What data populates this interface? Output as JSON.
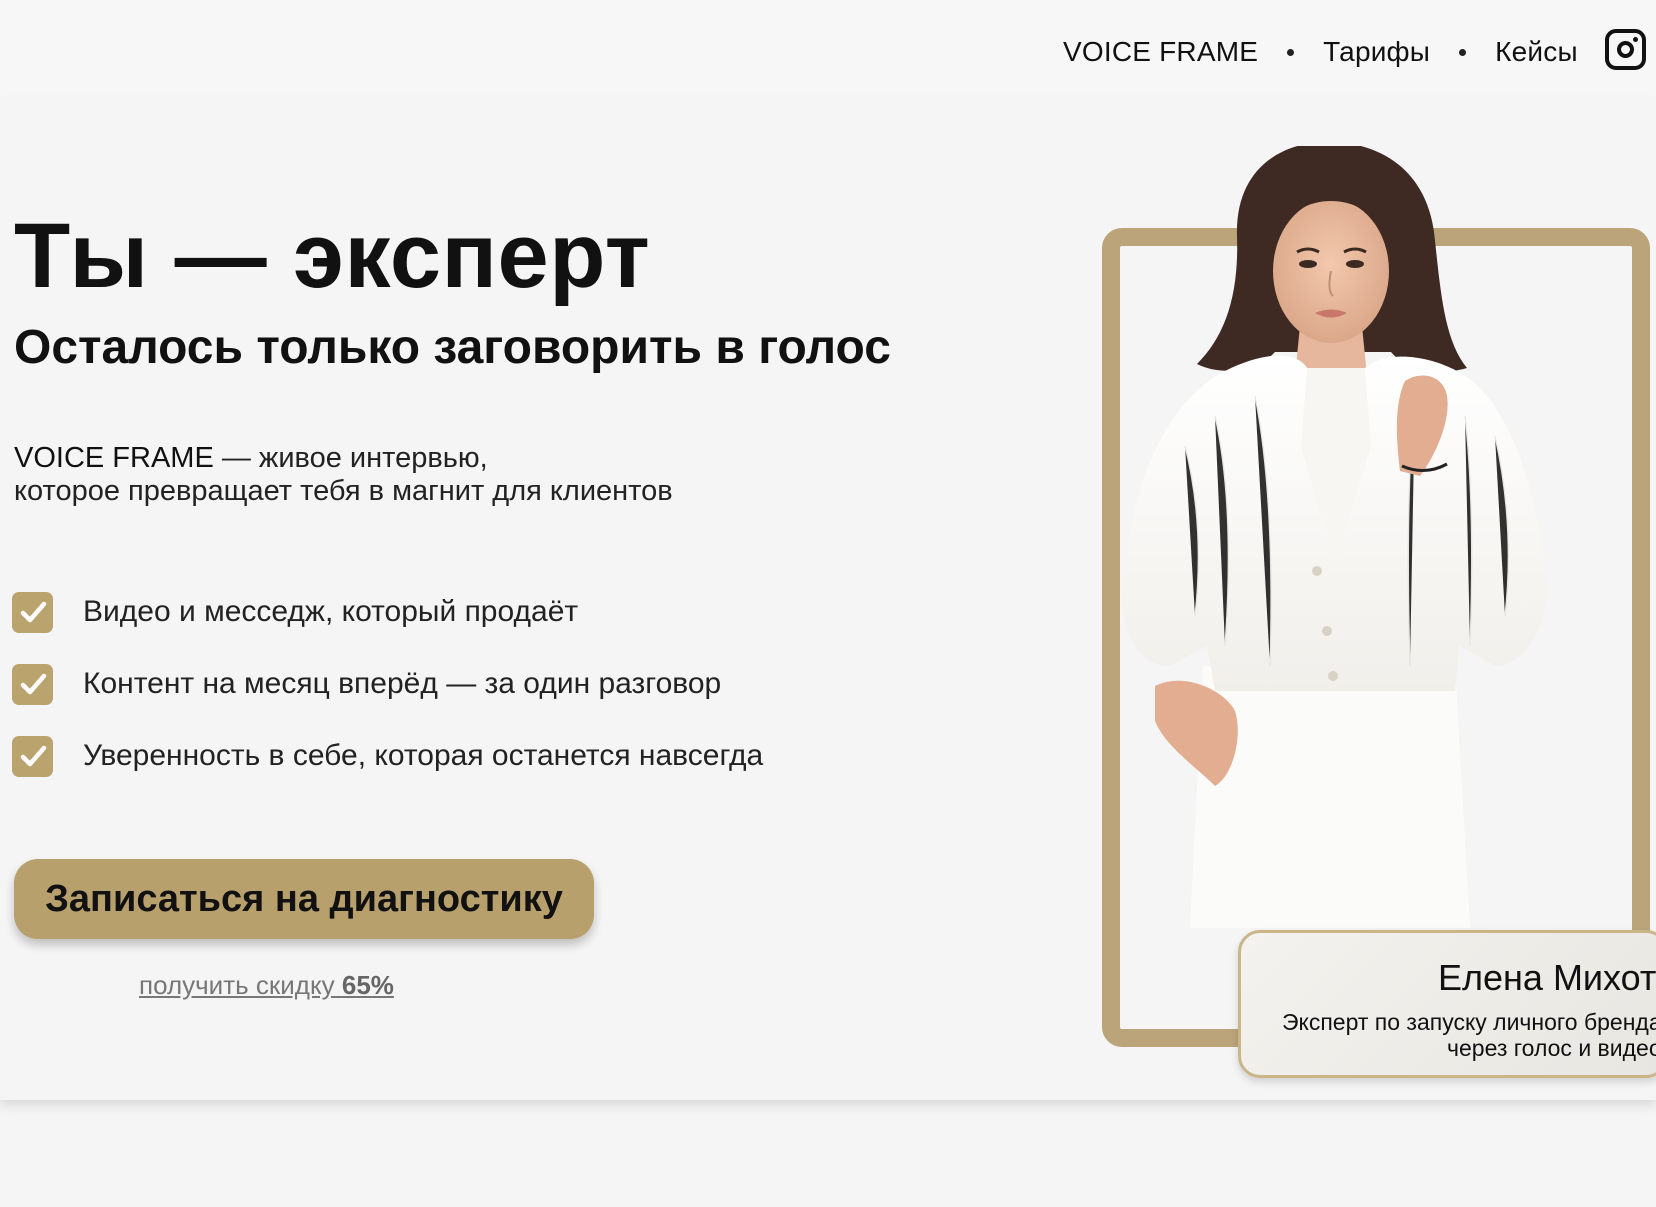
{
  "nav": {
    "items": [
      {
        "label": "VOICE FRAME"
      },
      {
        "label": "Тарифы"
      },
      {
        "label": "Кейсы"
      }
    ],
    "social_icon": "instagram-icon"
  },
  "hero": {
    "title": "Ты — эксперт",
    "subtitle": "Осталось только заговорить в голос",
    "lead_brand": "VOICE FRAME",
    "lead_line1": " — живое интервью,",
    "lead_line2": "которое превращает тебя в магнит для клиентов",
    "features": [
      "Видео и месседж, который продаёт",
      "Контент на месяц вперёд — за один разговор",
      "Уверенность в себе, которая останется навсегда"
    ],
    "cta_label": "Записаться на диагностику",
    "discount_text": "получить скидку ",
    "discount_value": "65%"
  },
  "expert": {
    "name": "Елена Михота",
    "role_line1": "Эксперт по запуску личного бренда",
    "role_line2": "через голос и видео"
  },
  "colors": {
    "accent": "#b8a06d",
    "frame": "#bba47a",
    "background": "#f5f5f5"
  }
}
